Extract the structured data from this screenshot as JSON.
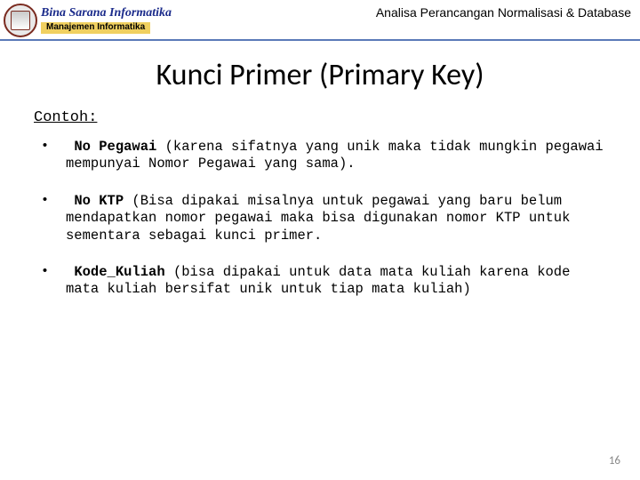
{
  "header": {
    "institution": "Bina Sarana Informatika",
    "department": "Manajemen Informatika",
    "course": "Analisa Perancangan Normalisasi & Database"
  },
  "slide": {
    "title": "Kunci Primer (Primary Key)",
    "subheading": "Contoh:",
    "bullets": [
      {
        "term": "No Pegawai",
        "rest": " (karena sifatnya yang unik maka tidak mungkin pegawai mempunyai Nomor Pegawai yang sama)."
      },
      {
        "term": "No KTP",
        "rest": " (Bisa dipakai misalnya untuk pegawai yang baru belum mendapatkan nomor pegawai maka bisa digunakan nomor KTP untuk sementara sebagai kunci primer."
      },
      {
        "term": "Kode_Kuliah",
        "rest": " (bisa dipakai untuk data mata kuliah karena kode mata kuliah bersifat unik untuk tiap mata kuliah)"
      }
    ],
    "page_number": "16"
  }
}
